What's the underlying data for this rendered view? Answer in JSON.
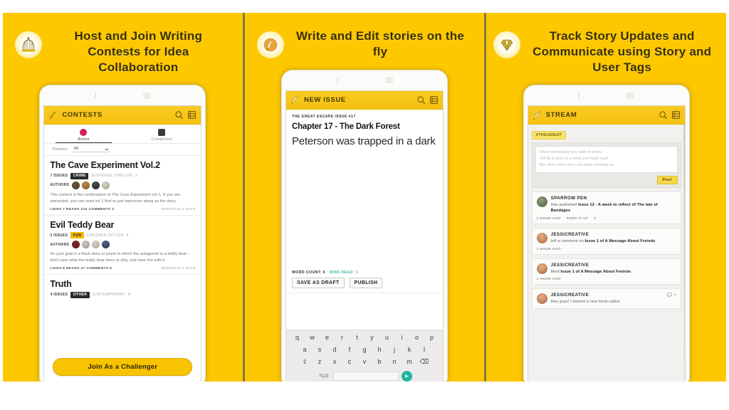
{
  "meta": {
    "brand_yellow": "#fdc800",
    "accent_gold": "#f8c301",
    "divider_color": "#5c4a06"
  },
  "panels": [
    {
      "id": "panel-contests",
      "icon": "birdcage-icon",
      "headline": "Host and Join Writing Contests for Idea Collaboration",
      "app": {
        "title": "CONTESTS",
        "logo_icon": "feather-quill-icon",
        "actions": [
          "search-icon",
          "menu-icon"
        ],
        "tabs": [
          {
            "label": "Active",
            "selected": true
          },
          {
            "label": "Completed",
            "selected": false
          }
        ],
        "filter": {
          "label": "Themes:",
          "value": "All"
        },
        "contests": [
          {
            "title": "The Cave Experiment Vol.2",
            "issues_label": "7 ISSUES",
            "chip": "CRIME",
            "chip_style": "dark",
            "genre": "SUSPENSE THRILLER",
            "genre_count": "5",
            "author_label": "AUTHORS",
            "avatars": [
              "a1",
              "a2",
              "a3",
              "a4"
            ],
            "description": "This contest is the continuation of The Cave Experiment vol 1. If you are interested, you can read vol 1 first or just improvise along as the story.",
            "stats": "LIKES 7   READS 210   COMMENTS 3",
            "ends": "ENDING IN 2 DAYS"
          },
          {
            "title": "Evil Teddy Bear",
            "issues_label": "3 ISSUES",
            "chip": "FUN",
            "chip_style": "yellow",
            "genre": "CHILDREN FICTION",
            "genre_count": "4",
            "author_label": "AUTHORS",
            "avatars": [
              "a5",
              "a6",
              "a7",
              "a8"
            ],
            "description": "So your goal is a flash story or poem in which the antagonist is a teddy bear - don't care what the teddy bear does or why, just have fun with it.",
            "stats": "LIKES 6   READS 47   COMMENTS 6",
            "ends": "ENDING IN 3 DAYS"
          },
          {
            "title": "Truth",
            "issues_label": "4 ISSUES",
            "chip": "OTHER",
            "chip_style": "dark",
            "genre": "CONTEMPORARY",
            "genre_count": "8",
            "author_label": "",
            "avatars": [],
            "description": "",
            "stats": "",
            "ends": ""
          }
        ],
        "cta": "Join As a Challenger"
      }
    },
    {
      "id": "panel-editor",
      "icon": "quill-pen-icon",
      "headline": "Write and Edit stories on the fly",
      "app": {
        "title": "NEW ISSUE",
        "logo_icon": "feather-quill-icon",
        "actions": [
          "search-icon",
          "menu-icon"
        ],
        "kicker": "THE GREAT ESCAPE ISSUE #17",
        "chapter": "Chapter 17 - The Dark Forest",
        "body": "Peterson was trapped in a dark",
        "word_count": "WORD COUNT: 6",
        "mins_read": "MINS READ: 1",
        "buttons": [
          "SAVE AS DRAFT",
          "PUBLISH"
        ],
        "keyboard": {
          "row1": [
            "q",
            "w",
            "e",
            "r",
            "t",
            "y",
            "u",
            "i",
            "o",
            "p"
          ],
          "row2": [
            "a",
            "s",
            "d",
            "f",
            "g",
            "h",
            "j",
            "k",
            "l"
          ],
          "row3": [
            "⇧",
            "z",
            "x",
            "c",
            "v",
            "b",
            "n",
            "m",
            "⌫"
          ],
          "row4_left": "?123",
          "row4_go": "➤"
        }
      }
    },
    {
      "id": "panel-stream",
      "icon": "diamond-gem-icon",
      "headline": "Track Story Updates and Communicate using Story and User Tags",
      "app": {
        "title": "Stream",
        "logo_icon": "feather-quill-icon",
        "actions": [
          "search-icon",
          "menu-icon"
        ],
        "tag_chip": "#THEGREAT",
        "composer": {
          "placeholder_lines": [
            "Share something you want to know.",
            "Tell @ a story or a what you have read",
            "this short story story you been working on."
          ],
          "post_label": "Post"
        },
        "feed": [
          {
            "avatar": "u1",
            "name": "SPARROW PEN",
            "text_plain": "Has published ",
            "text_bold": "Issue 12 - A week to reflect of The tale of Bandages",
            "time": "1 HOUR AGO",
            "reaction": "KEEP IT UP",
            "reaction_count": "0",
            "comment_count": ""
          },
          {
            "avatar": "u2",
            "name": "JESSICREATIVE",
            "text_plain": "left a comment on ",
            "text_bold": "Issue 1 of A Message About Freinds",
            "time": "1 HOUR AGO",
            "reaction": "",
            "reaction_count": "",
            "comment_count": ""
          },
          {
            "avatar": "u2",
            "name": "JESSICREATIVE",
            "text_plain": "liked ",
            "text_bold": "Issue 1 of A Message About Freinds",
            "time": "1 HOUR AGO",
            "reaction": "",
            "reaction_count": "",
            "comment_count": ""
          },
          {
            "avatar": "u2",
            "name": "JESSICREATIVE",
            "text_plain": "Hey guys! I started a new book called",
            "text_bold": "",
            "time": "",
            "reaction": "",
            "reaction_count": "",
            "comment_count": "0"
          }
        ]
      }
    }
  ]
}
